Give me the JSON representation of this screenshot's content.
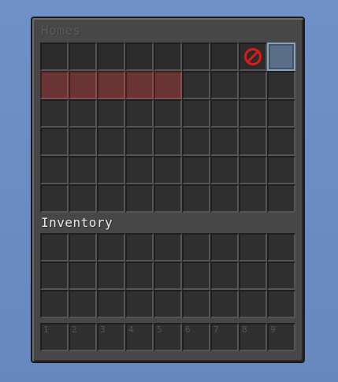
{
  "homes": {
    "title": "Homes",
    "rows": [
      [
        "dark",
        "dark",
        "dark",
        "dark",
        "dark",
        "dark",
        "dark",
        "deny",
        "blue"
      ],
      [
        "red",
        "red",
        "red",
        "red",
        "red",
        "empty",
        "empty",
        "empty",
        "empty"
      ],
      [
        "empty",
        "empty",
        "empty",
        "empty",
        "empty",
        "empty",
        "empty",
        "empty",
        "empty"
      ],
      [
        "empty",
        "empty",
        "empty",
        "empty",
        "empty",
        "empty",
        "empty",
        "empty",
        "empty"
      ],
      [
        "empty",
        "empty",
        "empty",
        "empty",
        "empty",
        "empty",
        "empty",
        "empty",
        "empty"
      ],
      [
        "empty",
        "empty",
        "empty",
        "empty",
        "empty",
        "empty",
        "empty",
        "empty",
        "empty"
      ]
    ],
    "deny_icon": "no-entry-icon",
    "colors": {
      "red_slot": "#6a3434",
      "blue_slot": "#5a6f87",
      "deny_red": "#e01818"
    }
  },
  "inventory": {
    "title": "Inventory",
    "rows": 3,
    "cols": 9
  },
  "hotbar": {
    "labels": [
      "1",
      "2",
      "3",
      "4",
      "5",
      "6",
      "7",
      "8",
      "9"
    ]
  }
}
